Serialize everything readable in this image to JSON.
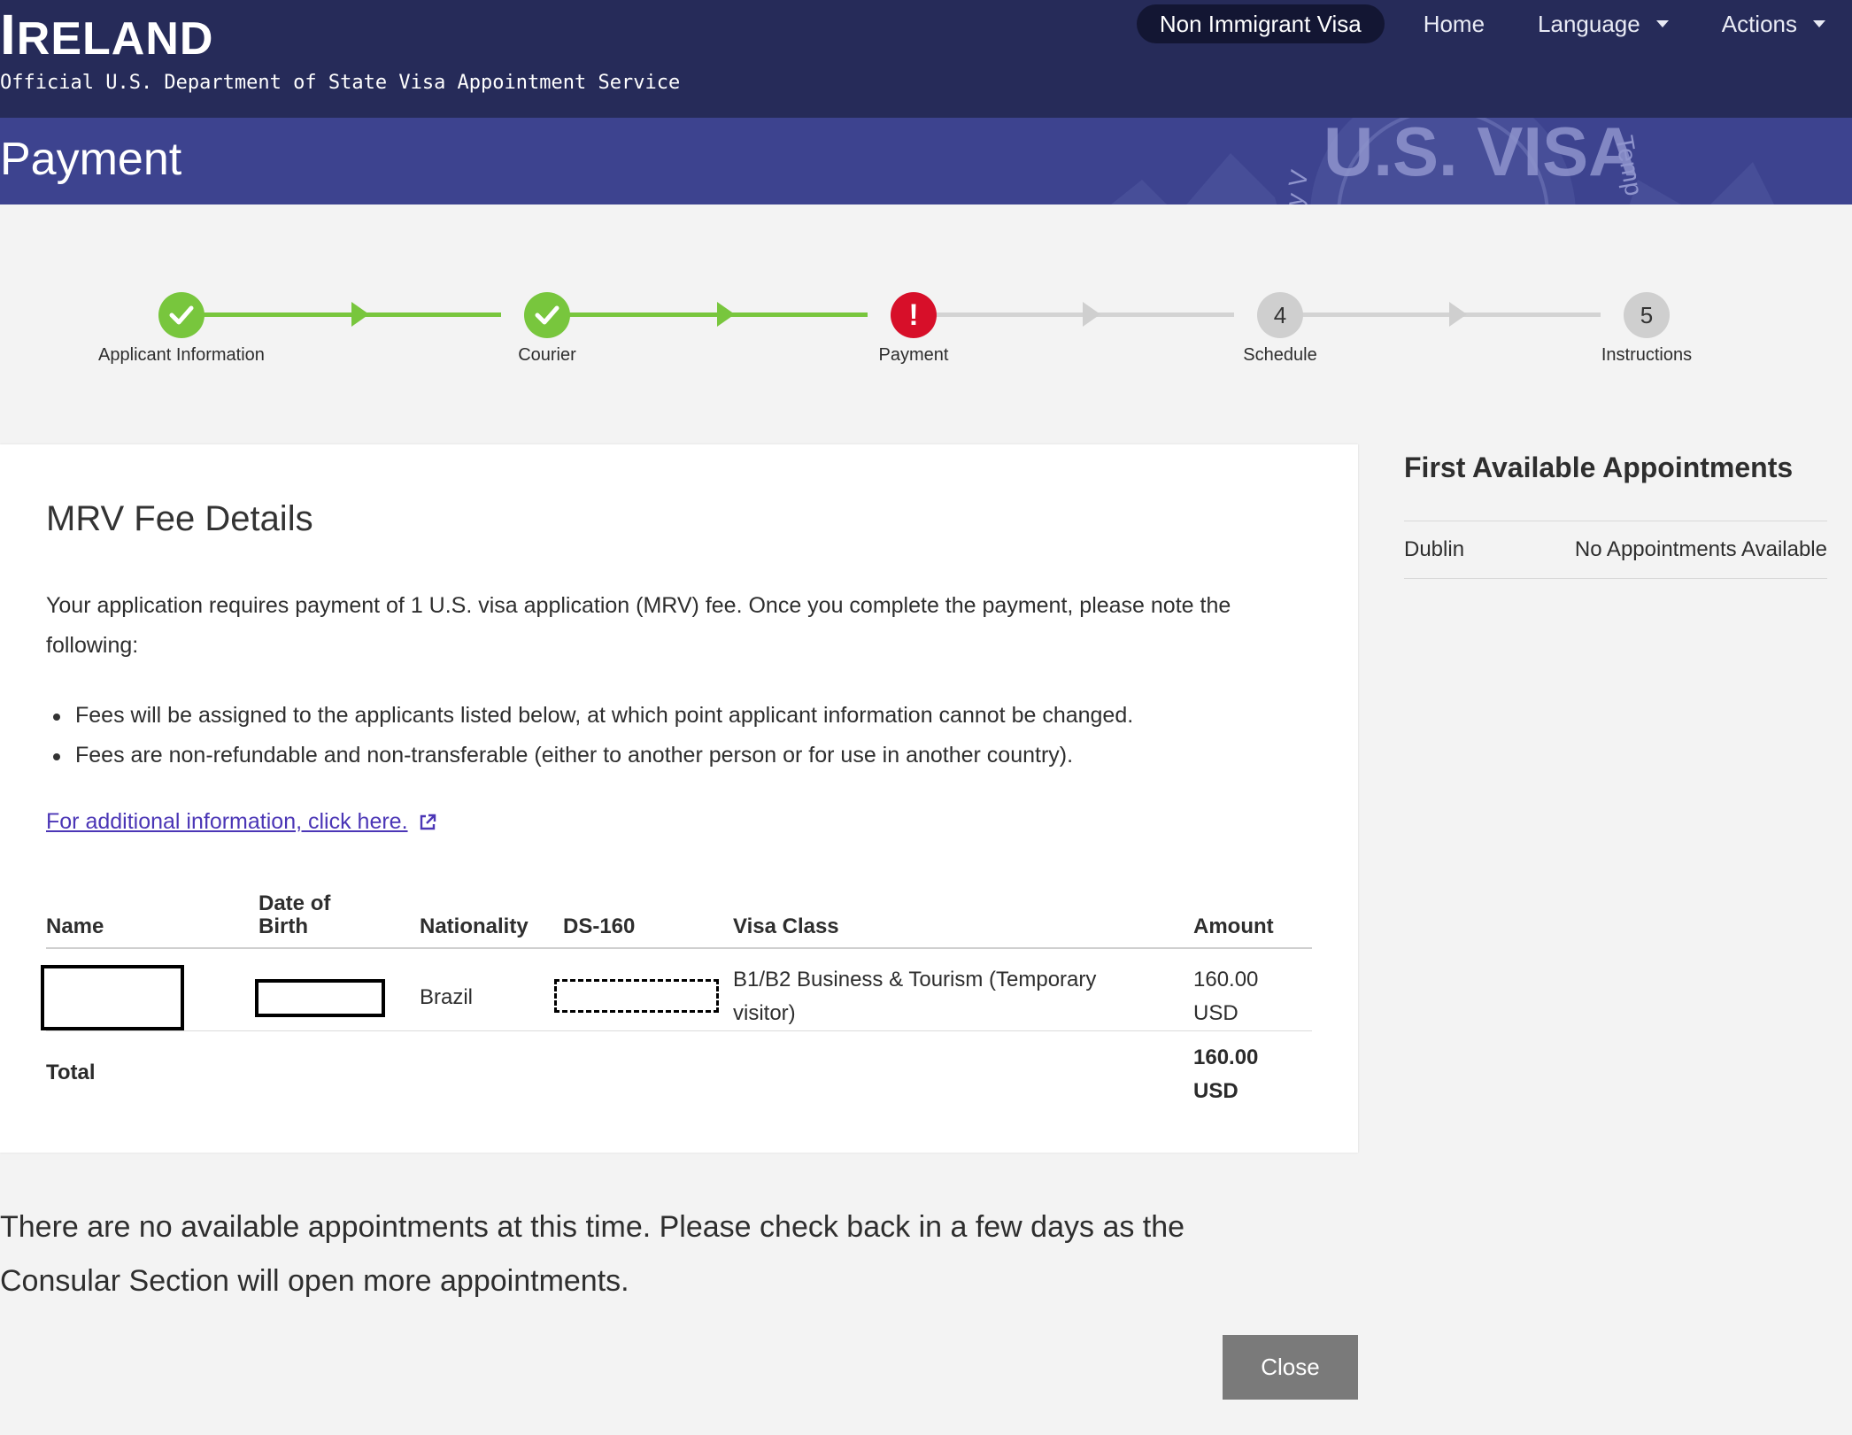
{
  "header": {
    "country_cap": "I",
    "country_rest": "RELAND",
    "subtitle": "Official U.S. Department of State Visa Appointment Service",
    "nav": {
      "visa_type": "Non Immigrant Visa",
      "home": "Home",
      "language": "Language",
      "actions": "Actions"
    }
  },
  "band": {
    "title": "Payment",
    "seal_text": "U.S. VISA",
    "seal_side_left": "orary V",
    "seal_side_right": "Temp"
  },
  "steps": [
    {
      "label": "Applicant Information",
      "status": "complete"
    },
    {
      "label": "Courier",
      "status": "complete"
    },
    {
      "label": "Payment",
      "status": "error",
      "symbol": "!"
    },
    {
      "label": "Schedule",
      "status": "pending",
      "number": "4"
    },
    {
      "label": "Instructions",
      "status": "pending",
      "number": "5"
    }
  ],
  "fee_details": {
    "heading": "MRV Fee Details",
    "intro": "Your application requires payment of 1 U.S. visa application (MRV) fee. Once you complete the payment, please note the following:",
    "bullets": [
      "Fees will be assigned to the applicants listed below, at which point applicant information cannot be changed.",
      "Fees are non-refundable and non-transferable (either to another person or for use in another country)."
    ],
    "link_text": "For additional information, click here.",
    "table": {
      "headers": [
        "Name",
        "Date of Birth",
        "Nationality",
        "DS-160",
        "Visa Class",
        "Amount"
      ],
      "rows": [
        {
          "nationality": "Brazil",
          "visa_class": "B1/B2 Business & Tourism (Temporary visitor)",
          "amount": "160.00 USD"
        }
      ],
      "total_label": "Total",
      "total_amount": "160.00 USD"
    }
  },
  "side": {
    "heading": "First Available Appointments",
    "rows": [
      {
        "location": "Dublin",
        "availability": "No Appointments Available"
      }
    ]
  },
  "notice": "There are no available appointments at this time. Please check back in a few days as the Consular Section will open more appointments.",
  "close_label": "Close",
  "colors": {
    "header_bg": "#262b59",
    "band_bg": "#3d438f",
    "complete": "#78c63d",
    "error": "#d70f29",
    "pending": "#cfcfcf",
    "link": "#4b36b6"
  }
}
